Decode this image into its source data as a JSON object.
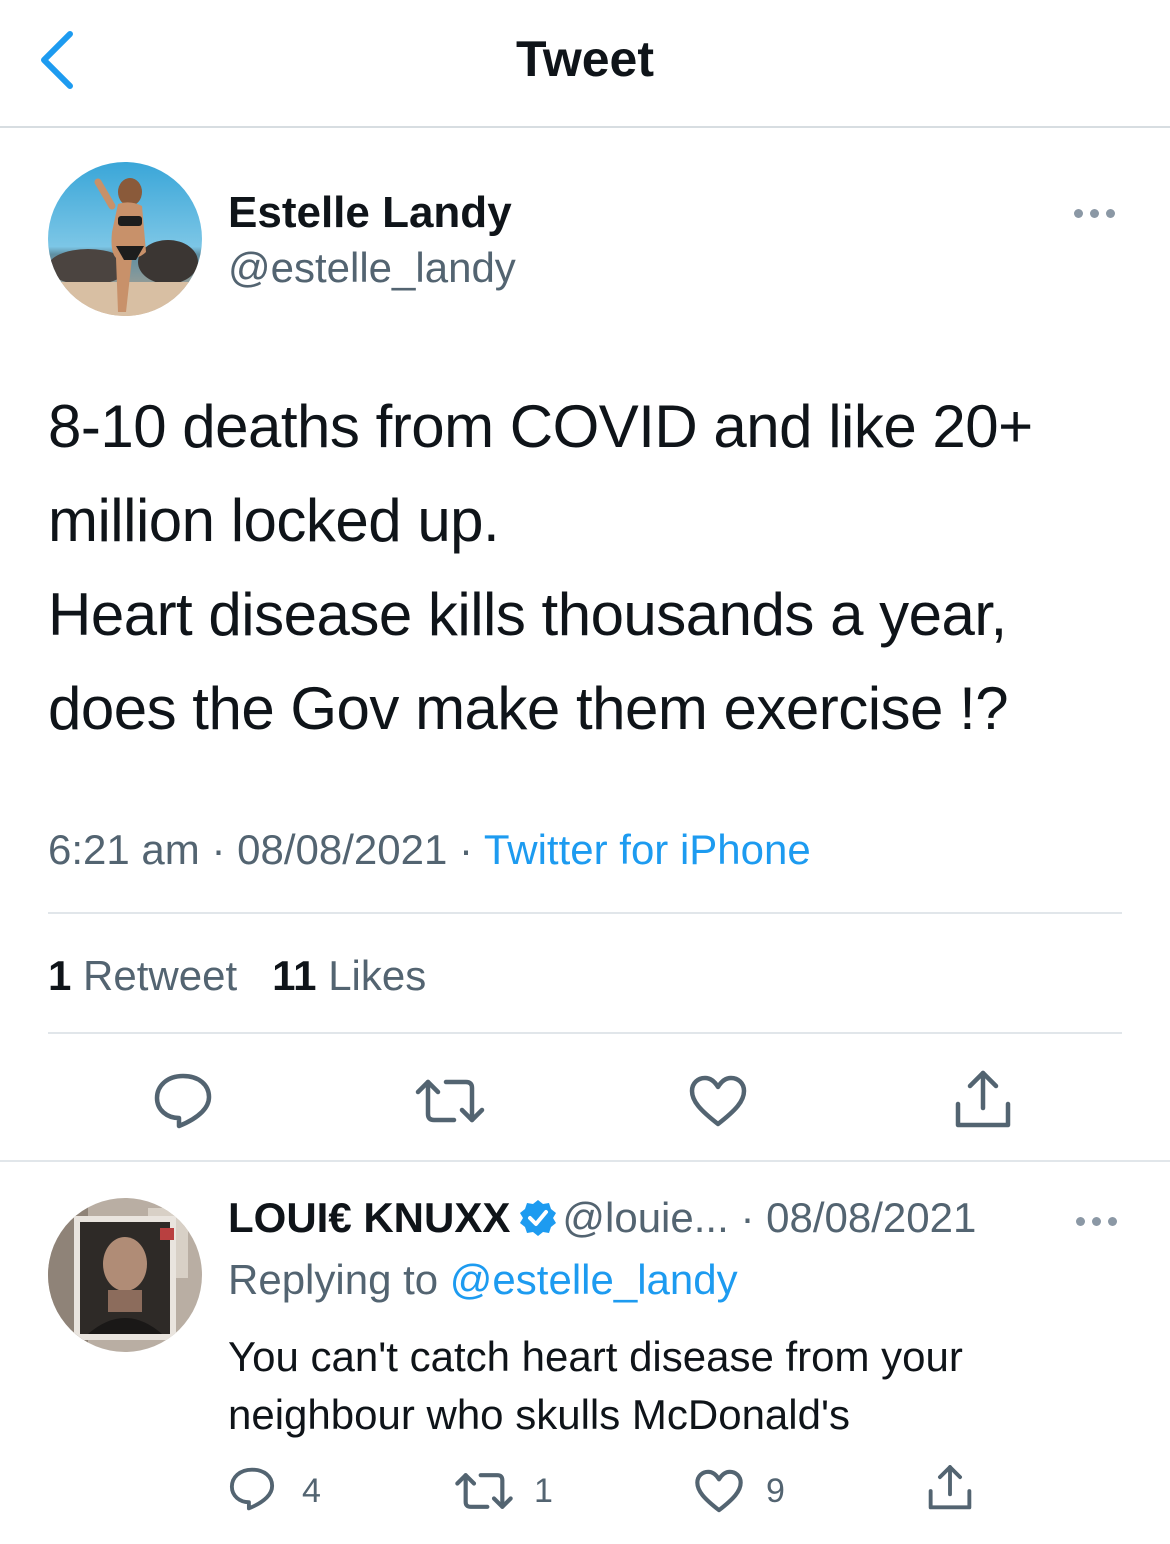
{
  "header": {
    "title": "Tweet"
  },
  "tweet": {
    "author_name": "Estelle Landy",
    "author_handle": "@estelle_landy",
    "text_lines": [
      "8-10 deaths from COVID and like 20+",
      "million locked up.",
      "Heart disease kills thousands a year,",
      "does the Gov make them exercise !?"
    ],
    "time": "6:21 am",
    "date": "08/08/2021",
    "separator": "·",
    "source": "Twitter for iPhone",
    "retweets_count": "1",
    "retweets_label": "Retweet",
    "likes_count": "11",
    "likes_label": "Likes"
  },
  "reply": {
    "author_name": "LOUI€ KNUXX",
    "author_handle": "@louie...",
    "separator": "·",
    "date": "08/08/2021",
    "replying_prefix": "Replying to",
    "replying_to": "@estelle_landy",
    "text_lines": [
      "You can't catch heart disease from your",
      "neighbour who skulls McDonald's"
    ],
    "reply_count": "4",
    "retweet_count": "1",
    "like_count": "9"
  },
  "colors": {
    "accent": "#1d9bf0",
    "secondary_text": "#536471",
    "icon": "#536471",
    "divider": "#e1e6ea"
  },
  "icons": {
    "back": "chevron-left-icon",
    "more": "more-horizontal-icon",
    "reply": "comment-icon",
    "retweet": "retweet-icon",
    "like": "heart-icon",
    "share": "share-icon",
    "verified": "verified-badge-icon"
  }
}
